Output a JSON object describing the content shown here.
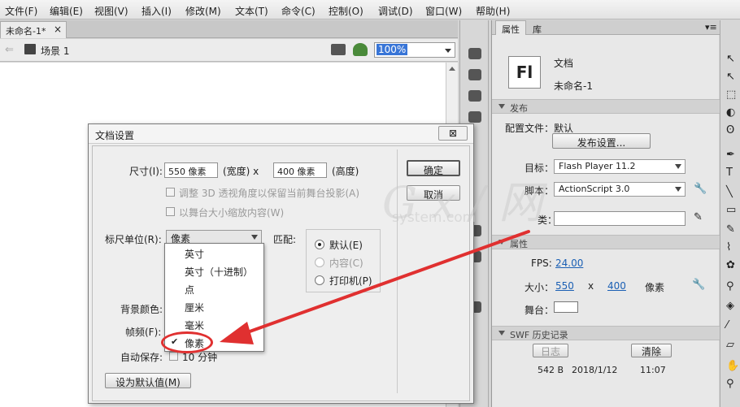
{
  "menubar": [
    "文件(F)",
    "编辑(E)",
    "视图(V)",
    "插入(I)",
    "修改(M)",
    "文本(T)",
    "命令(C)",
    "控制(O)",
    "调试(D)",
    "窗口(W)",
    "帮助(H)"
  ],
  "doc_tab": {
    "title": "未命名-1*",
    "close": "×"
  },
  "scene": {
    "label": "场景 1",
    "zoom": "100%"
  },
  "panel_tabs": [
    "属性",
    "库"
  ],
  "doc_info": {
    "icon_text": "Fl",
    "type": "文档",
    "name": "未命名-1"
  },
  "publish": {
    "header": "发布",
    "profile_label": "配置文件：",
    "profile_value": "默认",
    "settings_button": "发布设置...",
    "target_label": "目标：",
    "target_value": "Flash Player 11.2",
    "script_label": "脚本：",
    "script_value": "ActionScript 3.0",
    "class_label": "类："
  },
  "properties": {
    "header": "属性",
    "fps_label": "FPS:",
    "fps_value": "24.00",
    "size_label": "大小：",
    "width": "550",
    "x": "x",
    "height": "400",
    "unit": "像素",
    "stage_label": "舞台："
  },
  "swf_history": {
    "header": "SWF 历史记录",
    "log_button": "日志",
    "clear_button": "清除",
    "size": "542 B",
    "date": "2018/1/12",
    "time": "11:07"
  },
  "dialog": {
    "title": "文档设置",
    "close": "⊠",
    "size_label": "尺寸(I):",
    "width_value": "550 像素",
    "width_suffix": "(宽度) x",
    "height_value": "400 像素",
    "height_suffix": "(高度)",
    "ok_button": "确定",
    "cancel_button": "取消",
    "adjust_3d": "调整 3D 透视角度以保留当前舞台投影(A)",
    "scale_content": "以舞台大小缩放内容(W)",
    "ruler_label": "标尺单位(R):",
    "ruler_value": "像素",
    "match_label": "匹配:",
    "match_options": [
      "默认(E)",
      "内容(C)",
      "打印机(P)"
    ],
    "bg_label": "背景颜色:",
    "fps_label": "帧频(F):",
    "autosave_label": "自动保存:",
    "autosave_text": "10 分钟",
    "default_button": "设为默认值(M)"
  },
  "ruler_units": [
    {
      "label": "英寸",
      "checked": false
    },
    {
      "label": "英寸（十进制）",
      "checked": false
    },
    {
      "label": "点",
      "checked": false
    },
    {
      "label": "厘米",
      "checked": false
    },
    {
      "label": "毫米",
      "checked": false
    },
    {
      "label": "像素",
      "checked": true
    }
  ],
  "check_mark": "✔",
  "watermark": {
    "main": "G x / 网",
    "sub": "system.com"
  },
  "colors": {
    "arrow": "#e03030",
    "link": "#1a5fb4",
    "zoom_highlight": "#3875d7"
  }
}
